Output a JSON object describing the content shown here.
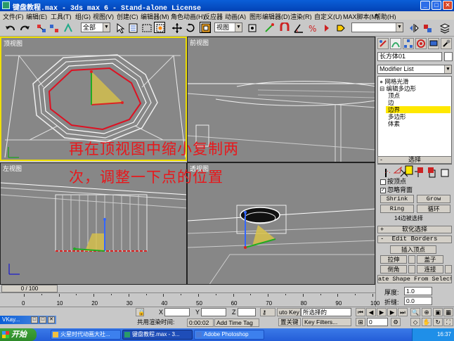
{
  "window": {
    "title": "键盘教程.max - 3ds max 6 - Stand-alone License"
  },
  "menu": [
    "文件(F)",
    "编辑(E)",
    "工具(T)",
    "组(G)",
    "视图(V)",
    "创建(C)",
    "编辑器(M)",
    "角色动画(H)",
    "反应器",
    "动画(A)",
    "图形编辑器(D)",
    "渲染(R)",
    "自定义(U)",
    "MAX脚本(M)",
    "帮助(H)"
  ],
  "toolbar": {
    "selection_filter": "全部",
    "ref_coord": "视图"
  },
  "viewports": {
    "top": "顶视图",
    "front": "前视图",
    "left": "左视图",
    "persp": "透视图"
  },
  "overlay": {
    "line1": "再在顶视图中缩小复制两",
    "line2": "次，调整一下点的位置"
  },
  "panel": {
    "object_name": "长方体01",
    "modifier_list": "Modifier List",
    "stack": {
      "mesh_smooth": "网格光滑",
      "edit_poly": "编辑多边形",
      "vertex": "顶点",
      "edge": "边",
      "border": "边界",
      "polygon": "多边形",
      "element": "体素"
    },
    "selection": {
      "header": "选择",
      "by_vertex": "按顶点",
      "ignore_backfacing": "忽略背面",
      "shrink": "Shrink",
      "grow": "Grow",
      "ring": "Ring",
      "loop": "循环",
      "status": "14边被选择"
    },
    "soft_selection": "软化选择",
    "edit_borders": {
      "header": "Edit Borders",
      "insert_vertex": "插入顶点",
      "extrude": "拉伸",
      "cap": "盖子",
      "chamfer": "倒角",
      "connect": "连接",
      "create_shape": "ate Shape From Select",
      "weight_label": "厚度:",
      "weight_value": "1.0",
      "crease_label": "折缝:",
      "crease_value": "0.0"
    }
  },
  "timeline": {
    "slider": "0 / 100",
    "ticks": [
      "0",
      "10",
      "20",
      "30",
      "40",
      "50",
      "60",
      "70",
      "80",
      "90",
      "100"
    ]
  },
  "status": {
    "x_label": "X",
    "y_label": "Y",
    "z_label": "Z",
    "auto_key": "uto Key",
    "selected": "所选择的",
    "set_key": "置关键",
    "key_filters": "Key Filters...",
    "shared_render": "共用渲染时间:",
    "render_time": "0:00:02",
    "add_time_tag": "Add Time Tag",
    "frame": "0"
  },
  "vkay": {
    "label": "VKay..."
  },
  "taskbar": {
    "start": "开始",
    "tasks": [
      "火星时代动画大社...",
      "键盘教程.max - 3...",
      "Adobe Photoshop"
    ],
    "clock": "16:37"
  }
}
